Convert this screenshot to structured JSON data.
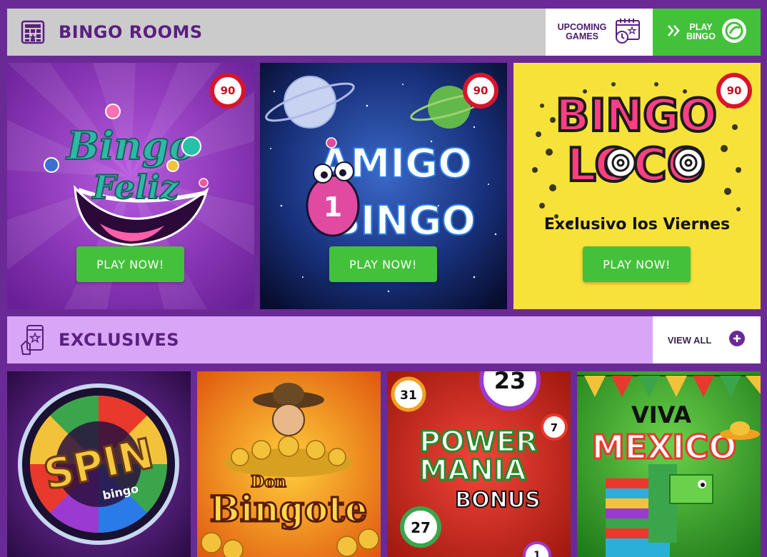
{
  "bingo_rooms": {
    "title": "BINGO ROOMS",
    "upcoming_label": "UPCOMING\nGAMES",
    "play_bingo_label": "PLAY\nBINGO"
  },
  "rooms": [
    {
      "logo_line1": "Bingo",
      "logo_line2": "Feliz",
      "badge": "90",
      "cta": "PLAY NOW!"
    },
    {
      "logo_line1": "AMIGO",
      "logo_line2": "BINGO",
      "badge": "90",
      "cta": "PLAY NOW!"
    },
    {
      "logo_line1": "BINGO",
      "logo_line2": "LOCO",
      "tagline": "Exclusivo los Viernes",
      "badge": "90",
      "cta": "PLAY NOW!"
    }
  ],
  "exclusives": {
    "title": "EXCLUSIVES",
    "view_all_label": "VIEW ALL"
  },
  "games": [
    {
      "name": "SPIN",
      "sub": "bingo"
    },
    {
      "name_line1": "Don",
      "name_line2": "Bingote"
    },
    {
      "name_line1": "POWER",
      "name_line2": "MANIA",
      "name_line3": "BONUS",
      "balls": [
        "31",
        "23",
        "7",
        "27",
        "1"
      ]
    },
    {
      "name_line1": "VIVA",
      "name_line2": "MEXICO"
    }
  ],
  "colors": {
    "page_bg": "#6a2a96",
    "accent_green": "#43c13a",
    "brand_purple": "#5a1f80",
    "badge_red": "#d8152b"
  }
}
